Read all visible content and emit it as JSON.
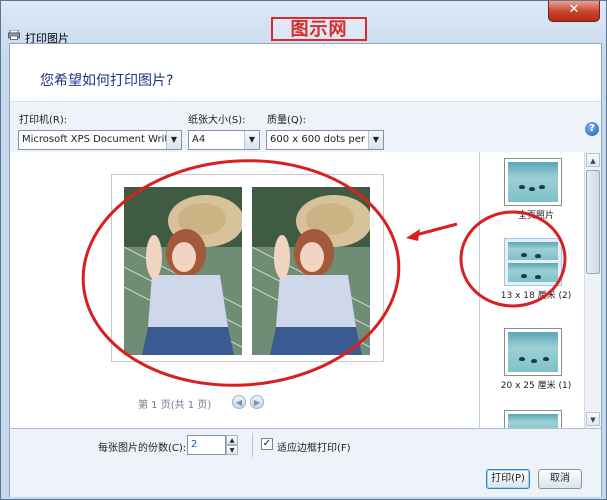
{
  "window": {
    "title": "打印图片",
    "watermark": "图示网",
    "close_symbol": "✕"
  },
  "header": {
    "heading": "您希望如何打印图片?"
  },
  "settings": {
    "printer_label": "打印机(R):",
    "printer_value": "Microsoft XPS Document Writer",
    "paper_size_label": "纸张大小(S):",
    "paper_size_value": "A4",
    "quality_label": "质量(Q):",
    "quality_value": "600 x 600 dots per inch",
    "help_symbol": "?"
  },
  "preview": {
    "pager_text": "第 1 页(共 1 页)",
    "prev_symbol": "◀",
    "next_symbol": "▶"
  },
  "layouts": {
    "items": [
      {
        "label": "全页照片",
        "selected": false
      },
      {
        "label": "13 x 18 厘米 (2)",
        "selected": true
      },
      {
        "label": "20 x 25 厘米 (1)",
        "selected": false
      },
      {
        "label": "",
        "selected": false
      }
    ],
    "scroll_up": "▲",
    "scroll_down": "▼"
  },
  "footer": {
    "copies_label": "每张图片的份数(C):",
    "copies_value": "2",
    "spin_up": "▲",
    "spin_down": "▼",
    "fit_label": "适应边框打印(F)",
    "fit_checked_mark": "✓",
    "print_button": "打印(P)",
    "cancel_button": "取消"
  },
  "colors": {
    "annotation_red": "#d92020",
    "heading_blue": "#1e3287"
  }
}
